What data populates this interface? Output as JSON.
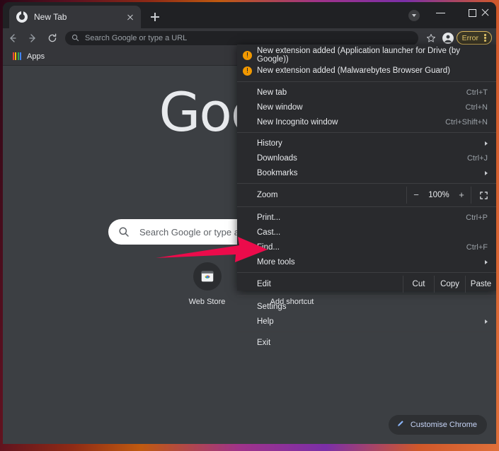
{
  "window": {
    "controls": {
      "minimize": "minimize-button",
      "maximize": "maximize-button",
      "close": "close-button"
    }
  },
  "tabstrip": {
    "tab_title": "New Tab",
    "new_tab_label": "+",
    "tab_search_icon": "chevron-down-circle-icon"
  },
  "toolbar": {
    "back_icon": "back-arrow-icon",
    "forward_icon": "forward-arrow-icon",
    "reload_icon": "reload-icon",
    "omnibox_placeholder": "Search Google or type a URL",
    "star_icon": "bookmark-star-icon",
    "profile_icon": "profile-avatar-icon",
    "error_label": "Error",
    "menu_icon": "three-dot-menu-icon"
  },
  "bookmarks": {
    "apps_label": "Apps",
    "apps_icon": "apps-grid-icon",
    "apps_colors": [
      "#ea4335",
      "#fbbc04",
      "#34a853",
      "#4285f4"
    ]
  },
  "ntp": {
    "logo_text": "Google",
    "fakebox_placeholder": "Search Google or type a URL",
    "search_icon": "search-magnifier-icon",
    "shortcuts": [
      {
        "name": "Web Store",
        "icon": "chrome-web-store-icon"
      },
      {
        "name": "Add shortcut",
        "icon": "plus-icon"
      }
    ],
    "customise_label": "Customise Chrome",
    "customise_icon": "pencil-edit-icon"
  },
  "menu": {
    "notifications": [
      {
        "text": "New extension added (Application launcher for Drive (by Google))",
        "icon": "warning-icon"
      },
      {
        "text": "New extension added (Malwarebytes Browser Guard)",
        "icon": "warning-icon"
      }
    ],
    "group1": [
      {
        "label": "New tab",
        "accel": "Ctrl+T"
      },
      {
        "label": "New window",
        "accel": "Ctrl+N"
      },
      {
        "label": "New Incognito window",
        "accel": "Ctrl+Shift+N"
      }
    ],
    "group2": [
      {
        "label": "History",
        "accel": "",
        "submenu": true
      },
      {
        "label": "Downloads",
        "accel": "Ctrl+J",
        "submenu": false
      },
      {
        "label": "Bookmarks",
        "accel": "",
        "submenu": true
      }
    ],
    "zoom": {
      "label": "Zoom",
      "minus": "−",
      "value": "100%",
      "plus": "+",
      "fullscreen_icon": "fullscreen-icon"
    },
    "group3": [
      {
        "label": "Print...",
        "accel": "Ctrl+P",
        "submenu": false
      },
      {
        "label": "Cast...",
        "accel": "",
        "submenu": false
      },
      {
        "label": "Find...",
        "accel": "Ctrl+F",
        "submenu": false
      },
      {
        "label": "More tools",
        "accel": "",
        "submenu": true
      }
    ],
    "edit": {
      "label": "Edit",
      "cut": "Cut",
      "copy": "Copy",
      "paste": "Paste"
    },
    "group4": [
      {
        "label": "Settings",
        "accel": "",
        "submenu": false
      },
      {
        "label": "Help",
        "accel": "",
        "submenu": true
      }
    ],
    "group5": [
      {
        "label": "Exit",
        "accel": "",
        "submenu": false
      }
    ]
  },
  "annotation": {
    "arrow_icon": "red-arrow-pointer",
    "arrow_color": "#ec0b4b",
    "points_to": "Settings"
  }
}
